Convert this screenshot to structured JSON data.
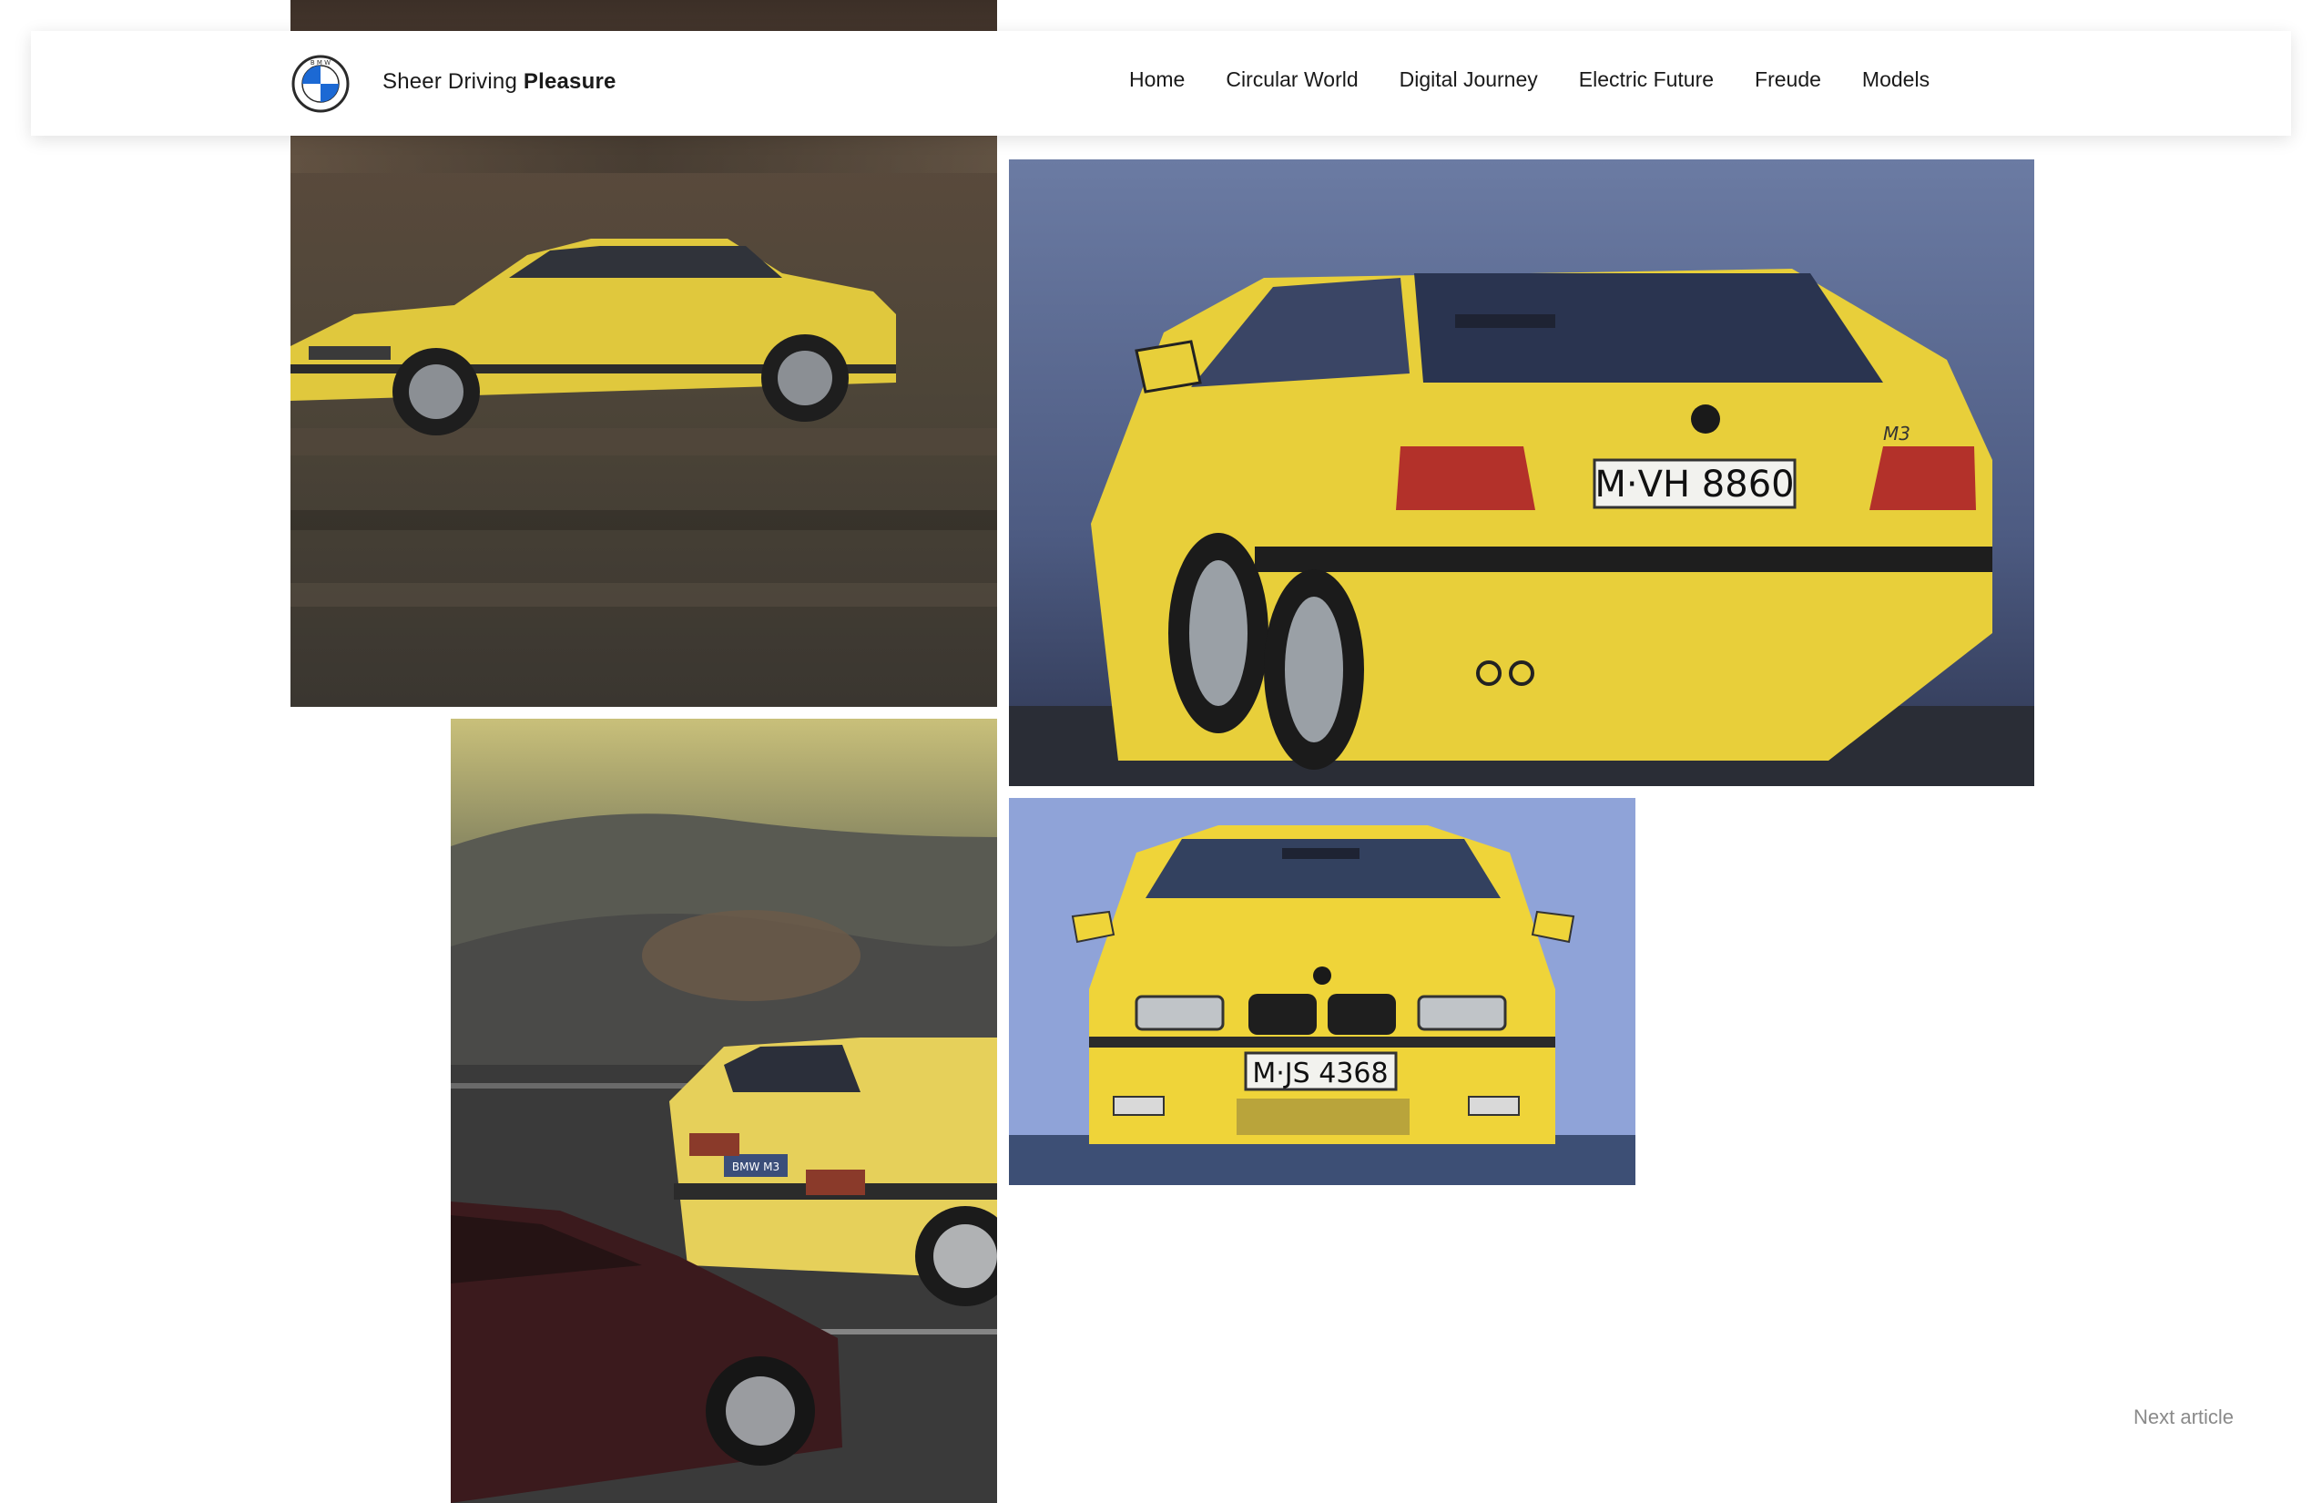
{
  "header": {
    "logo_icon": "bmw-roundel-icon",
    "brand_regular": "Sheer Driving",
    "brand_bold": "Pleasure",
    "nav": [
      {
        "label": "Home"
      },
      {
        "label": "Circular World"
      },
      {
        "label": "Digital Journey"
      },
      {
        "label": "Electric Future"
      },
      {
        "label": "Freude"
      },
      {
        "label": "Models"
      }
    ]
  },
  "gallery": {
    "rear_plate": "M·VH 8860",
    "front_plate": "M·JS 4368",
    "badge": "M3",
    "dusk_plate": "BMW M3"
  },
  "footer": {
    "next_article": "Next article"
  },
  "colors": {
    "car_yellow": "#e8cf3a",
    "sky_blue": "#6f7fa6",
    "front_sky": "#8ea2d8",
    "brand_blue": "#1c69d4"
  }
}
